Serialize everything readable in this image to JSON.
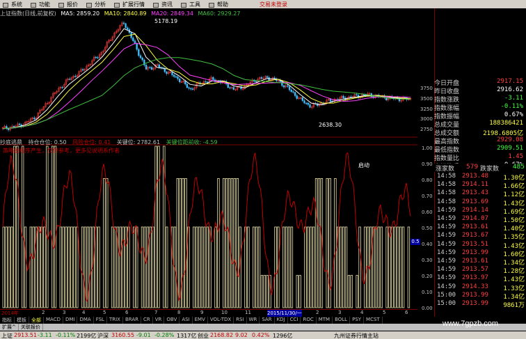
{
  "menu": {
    "items": [
      "系统",
      "功能",
      "报价",
      "分析",
      "扩展行情",
      "资讯",
      "工具",
      "帮助"
    ],
    "login": "交易未登录"
  },
  "title": {
    "name": "上证指数(日线,前复权)",
    "ma5": "MA5: 2859.20",
    "ma10": "MA10: 2840.89",
    "ma20": "MA20: 2849.34",
    "ma60": "MA60: 2929.27",
    "peak_label": "5178.19",
    "low_label": "2638.30"
  },
  "price_axis": [
    "3750",
    "3500",
    "3250",
    "3000",
    "2750"
  ],
  "stats": [
    {
      "label": "今日开盘",
      "value": "2917.15",
      "color": "#ff4040"
    },
    {
      "label": "昨日收盘",
      "value": "2916.62",
      "color": "#ffffff"
    },
    {
      "label": "指数涨跌",
      "value": "-3.11",
      "color": "#40ff40"
    },
    {
      "label": "指数涨幅",
      "value": "-0.11%",
      "color": "#40ff40"
    },
    {
      "label": "指数振幅",
      "value": "0.67%",
      "color": "#ffffff"
    },
    {
      "label": "总成交量",
      "value": "188386421",
      "color": "#ffff40"
    },
    {
      "label": "总成交额",
      "value": "2198.6805亿",
      "color": "#ffff40"
    },
    {
      "label": "最高指数",
      "value": "2929.08",
      "color": "#ff4040"
    },
    {
      "label": "最低指数",
      "value": "2909.51",
      "color": "#40ff40"
    },
    {
      "label": "指数量比",
      "value": "1.45",
      "color": "#ff4040"
    },
    {
      "label": "上证换手",
      "value": "0.67%",
      "color": "#ffffff"
    }
  ],
  "updown": {
    "up_label": "涨家数",
    "up_value": "579",
    "down_label": "跌家数",
    "down_value": "485"
  },
  "ticks": [
    {
      "time": "14:58",
      "price": "2913.48",
      "vol": "1.30亿"
    },
    {
      "time": "14:58",
      "price": "2914.11",
      "vol": "1.66亿"
    },
    {
      "time": "14:58",
      "price": "2913.43",
      "vol": "1.12亿"
    },
    {
      "time": "14:58",
      "price": "2913.69",
      "vol": "1.43亿"
    },
    {
      "time": "14:59",
      "price": "2914.14",
      "vol": "1.69亿"
    },
    {
      "time": "14:59",
      "price": "2914.07",
      "vol": "1.50亿"
    },
    {
      "time": "14:59",
      "price": "2913.61",
      "vol": "1.40亿"
    },
    {
      "time": "14:59",
      "price": "2913.67",
      "vol": "1.35亿"
    },
    {
      "time": "14:59",
      "price": "2913.51",
      "vol": "1.43亿"
    },
    {
      "time": "14:59",
      "price": "2913.99",
      "vol": "1.60亿"
    },
    {
      "time": "14:59",
      "price": "2913.61",
      "vol": "1.34亿"
    },
    {
      "time": "14:59",
      "price": "2913.57",
      "vol": "1.28亿"
    },
    {
      "time": "14:59",
      "price": "2913.97",
      "vol": "1.43亿"
    },
    {
      "time": "14:59",
      "price": "2914.33",
      "vol": "1.33亿"
    },
    {
      "time": "15:00",
      "price": "2913.99",
      "vol": "1.34亿"
    },
    {
      "time": "15:00",
      "price": "2913.99",
      "vol": "9861万"
    }
  ],
  "indicator": {
    "name": "抄底逃鼎",
    "hold": "持仓仓位: 0.50",
    "risk": "风险仓位: 0.41",
    "key": "关键位: 2782.61",
    "dist": "关键位距前收: -4.59",
    "note": "策略由程序产生，仅供参考，更多见说明系作者",
    "signal_label": "启动",
    "axis": [
      "1.00",
      "0.90",
      "0.80",
      "0.70",
      "0.60",
      "0.50",
      "0.40",
      "0.30",
      "0.20",
      "0.10",
      "0.00"
    ],
    "marker": "0.5"
  },
  "dates": [
    "2014年",
    "2",
    "3",
    "4",
    "5",
    "6",
    "7",
    "8",
    "9",
    "10",
    "11",
    "2015/11/30/一",
    "2",
    "3",
    "4",
    "5",
    "6"
  ],
  "tabs_row1": [
    "指标",
    "模板",
    "全部",
    "MACD",
    "DMI",
    "DMA",
    "FSL",
    "TRIX",
    "BRAR",
    "CR",
    "VR",
    "OBV",
    "ASI",
    "EMV",
    "VOL-TDX",
    "RSI",
    "WR",
    "SAR",
    "KDJ",
    "CCI",
    "ROC",
    "MTM",
    "BOLL",
    "PSY",
    "MCST"
  ],
  "tabs_row2": [
    "扩展^",
    "关联报价"
  ],
  "status": {
    "sh_label": "上证",
    "sh_value": "2913.51",
    "sh_chg": "-3.11",
    "sh_pct": "-0.11%",
    "sh_amt": "2199亿",
    "sz_label": "沪深",
    "sz_value": "3160.55",
    "sz_chg": "-9.01",
    "sz_pct": "-0.28%",
    "sz_amt": "1317亿",
    "cy_label": "创业",
    "cy_value": "2168.82",
    "cy_chg": "9.02",
    "cy_pct": "0.42%",
    "cy_amt": "1296亿",
    "broker": "九州证券行情主站"
  },
  "watermark": "www.7gpzb.com",
  "colors": {
    "up": "#ff4040",
    "down": "#40ff40",
    "ma5": "#ffffff",
    "ma10": "#ffff40",
    "ma20": "#ff40ff",
    "ma60": "#40c040",
    "bars": "#e8e0a8",
    "indicator_line": "#c00000"
  },
  "chart_data": {
    "type": "line",
    "title": "上证指数(日线,前复权)",
    "price_range": [
      2638.3,
      5178.19
    ],
    "series_close_approx": [
      2050,
      2100,
      2200,
      2400,
      2800,
      3200,
      3500,
      3700,
      4000,
      4300,
      4800,
      5178,
      4500,
      3800,
      3900,
      3700,
      3500,
      3200,
      3400,
      3500,
      3400,
      3200,
      3300,
      3500,
      3550,
      3450,
      3200,
      2900,
      2700,
      2800,
      2900,
      2950,
      3000,
      3050,
      3000,
      2950,
      2920,
      2913
    ],
    "indicator_bars": [
      0.5,
      1.0,
      0.5,
      0.5,
      1.0,
      0.5,
      0.5,
      0.5,
      0.5,
      0.8,
      0.5,
      0.5,
      0.5,
      0.5,
      1.0,
      0.5,
      0.8,
      0.5,
      0.5,
      0.5,
      0.8,
      0.8,
      0.5,
      0.5,
      0.2,
      0.5,
      0.5,
      0.2,
      0.5,
      0.8,
      0.8,
      0.5,
      0.2,
      0.5,
      0.5,
      0.5,
      0.5,
      0.5
    ],
    "indicator_range": [
      0,
      1
    ]
  }
}
